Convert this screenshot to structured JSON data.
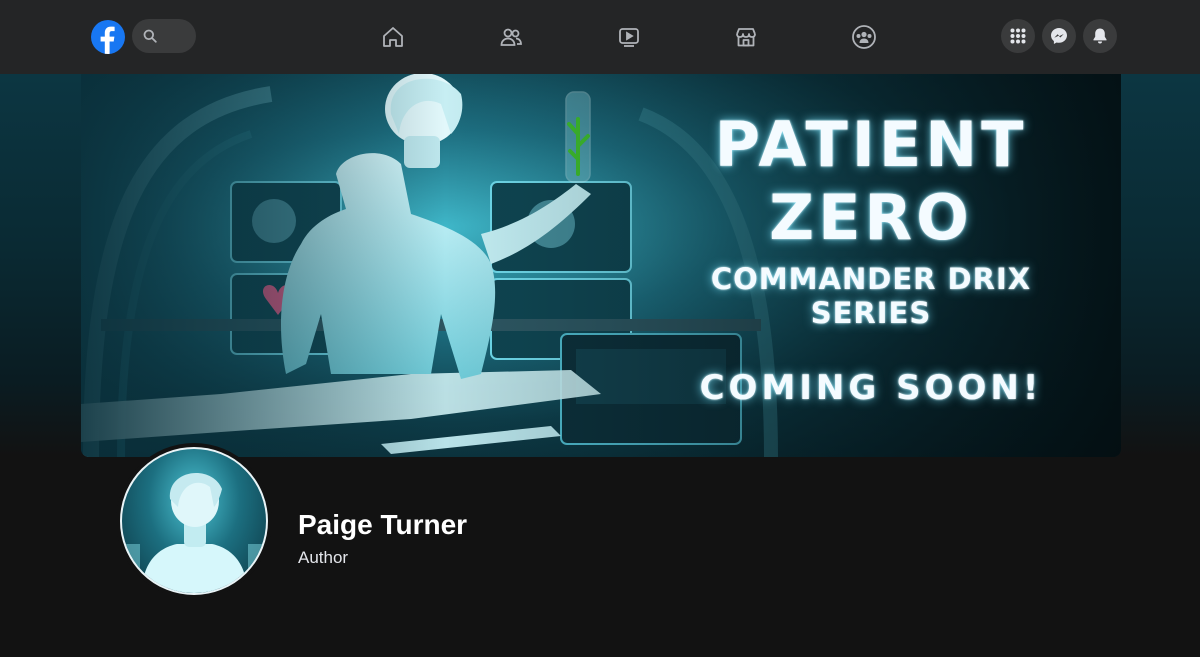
{
  "topbar": {
    "logo_icon": "facebook-logo-icon",
    "search_icon": "search-icon",
    "nav": [
      {
        "name": "home",
        "icon": "home-icon"
      },
      {
        "name": "friends",
        "icon": "friends-icon"
      },
      {
        "name": "watch",
        "icon": "video-icon"
      },
      {
        "name": "marketplace",
        "icon": "marketplace-icon"
      },
      {
        "name": "groups",
        "icon": "groups-icon"
      }
    ],
    "actions": [
      {
        "name": "menu",
        "icon": "grid-menu-icon"
      },
      {
        "name": "messenger",
        "icon": "messenger-icon"
      },
      {
        "name": "notifications",
        "icon": "bell-icon"
      }
    ],
    "colors": {
      "bar": "#242526",
      "brand": "#1877f2",
      "pill": "#3a3b3c"
    }
  },
  "cover": {
    "line1": "PATIENT",
    "line2": "ZERO",
    "series": "COMMANDER DRIX SERIES",
    "tagline": "COMING SOON!"
  },
  "profile": {
    "name": "Paige Turner",
    "role": "Author"
  }
}
